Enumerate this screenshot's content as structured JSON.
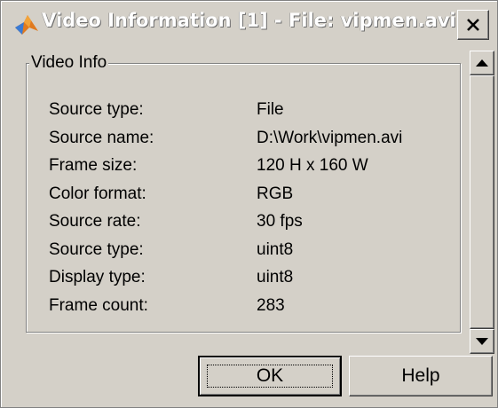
{
  "window": {
    "title": "Video Information [1] - File: vipmen.avi",
    "icon": "matlab-icon",
    "close_icon": "close-icon"
  },
  "group": {
    "label": "Video Info",
    "rows": [
      {
        "label": "Source type:",
        "value": "File"
      },
      {
        "label": "Source name:",
        "value": "D:\\Work\\vipmen.avi"
      },
      {
        "label": "Frame size:",
        "value": "120 H x 160 W"
      },
      {
        "label": "Color format:",
        "value": "RGB"
      },
      {
        "label": "Source rate:",
        "value": "30 fps"
      },
      {
        "label": "Source type:",
        "value": "uint8"
      },
      {
        "label": "Display type:",
        "value": "uint8"
      },
      {
        "label": "Frame count:",
        "value": "283"
      }
    ]
  },
  "buttons": {
    "ok": "OK",
    "help": "Help"
  },
  "colors": {
    "face": "#d4d0c8",
    "title_text": "#ffffff"
  }
}
